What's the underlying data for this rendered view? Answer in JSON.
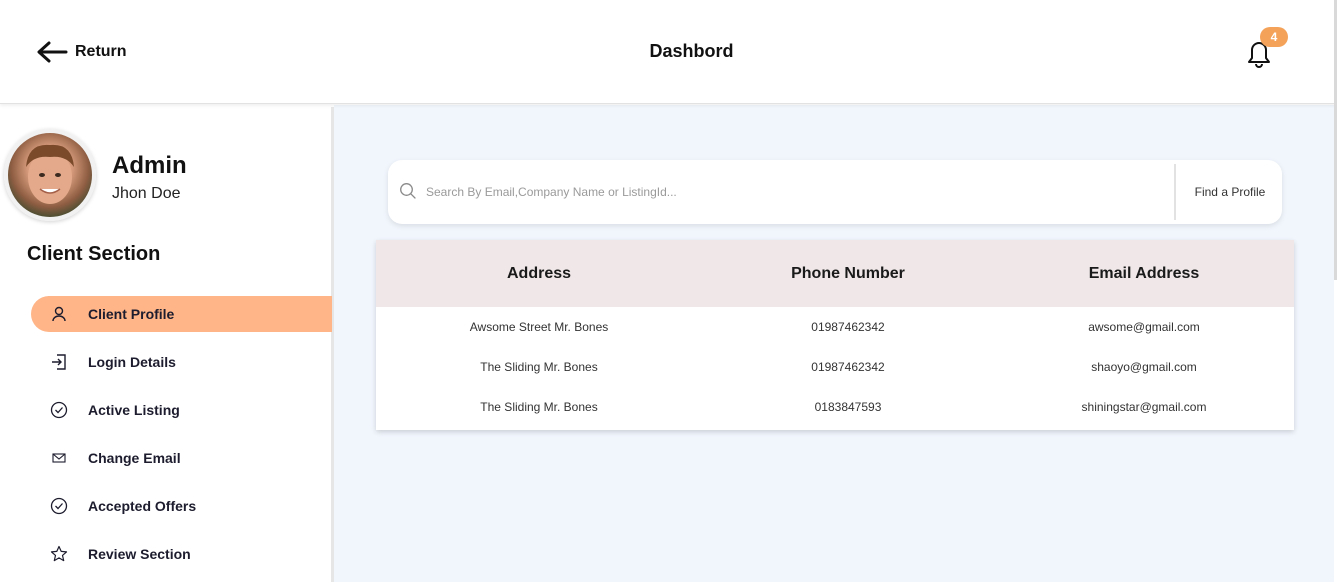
{
  "header": {
    "return_label": "Return",
    "title": "Dashbord",
    "notification_count": "4"
  },
  "sidebar": {
    "role": "Admin",
    "name": "Jhon Doe",
    "section_title": "Client Section",
    "items": [
      {
        "label": "Client Profile",
        "icon": "user-icon",
        "active": true
      },
      {
        "label": "Login Details",
        "icon": "login-icon",
        "active": false
      },
      {
        "label": "Active Listing",
        "icon": "check-circle-icon",
        "active": false
      },
      {
        "label": "Change Email",
        "icon": "mail-icon",
        "active": false
      },
      {
        "label": "Accepted Offers",
        "icon": "check-circle-icon",
        "active": false
      },
      {
        "label": "Review Section",
        "icon": "star-icon",
        "active": false
      }
    ]
  },
  "search": {
    "placeholder": "Search By Email,Company Name or ListingId...",
    "button_label": "Find a Profile"
  },
  "table": {
    "columns": [
      "Address",
      "Phone Number",
      "Email Address"
    ],
    "rows": [
      [
        "Awsome Street Mr. Bones",
        "01987462342",
        "awsome@gmail.com"
      ],
      [
        "The Sliding Mr. Bones",
        "01987462342",
        "shaoyo@gmail.com"
      ],
      [
        "The Sliding Mr. Bones",
        "0183847593",
        "shiningstar@gmail.com"
      ]
    ]
  },
  "colors": {
    "accent": "#ffb587",
    "badge": "#f4a259",
    "main_bg": "#f1f6fd",
    "table_header_bg": "#f0e8e8"
  }
}
